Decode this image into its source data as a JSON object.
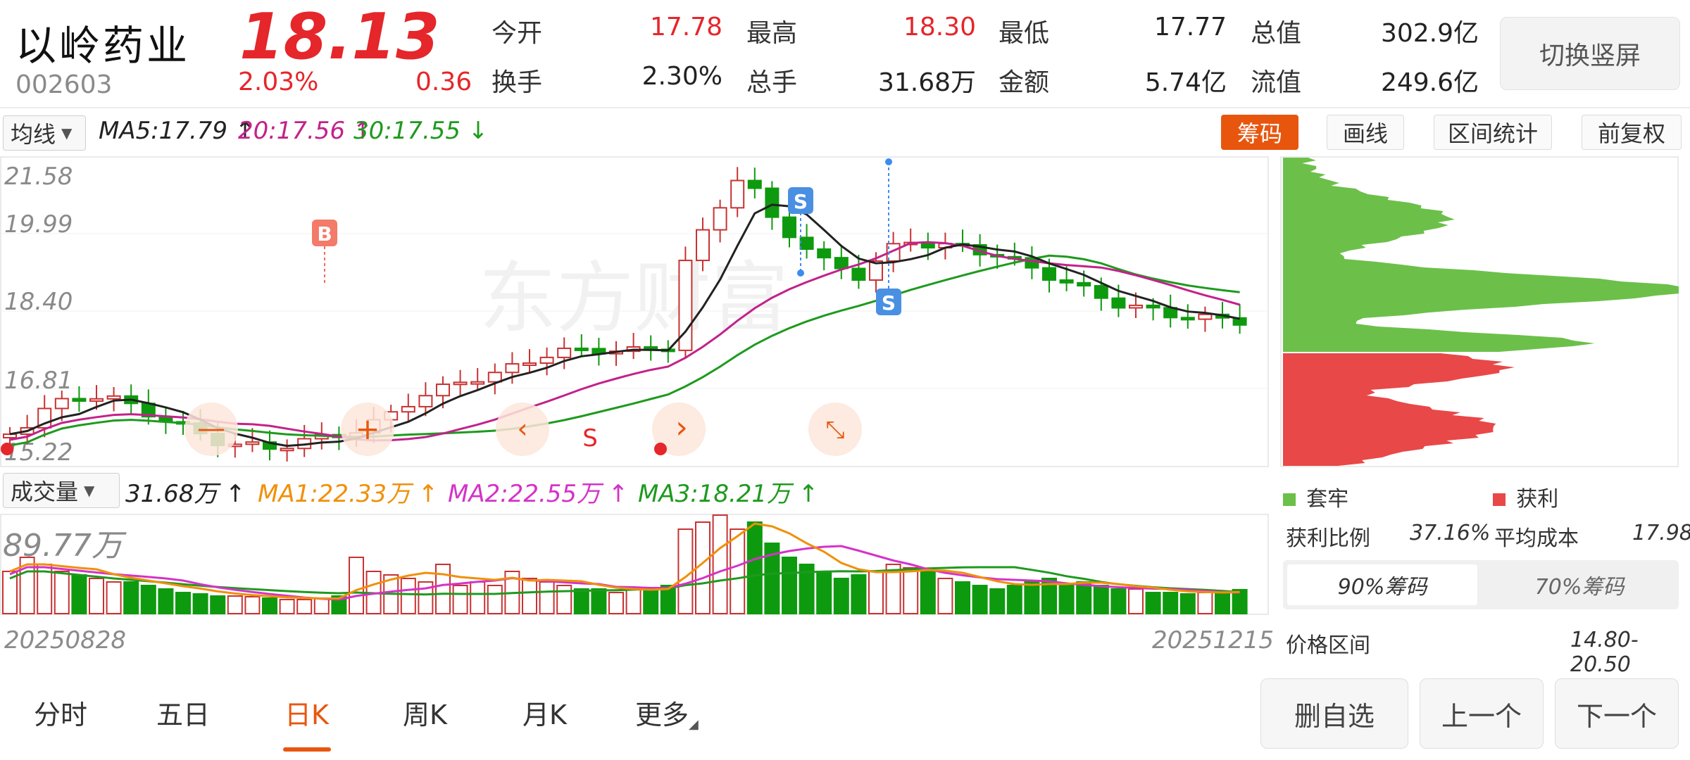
{
  "stock": {
    "name": "以岭药业",
    "code": "002603",
    "price": "18.13",
    "change_pct": "2.03%",
    "change": "0.36"
  },
  "stats": [
    {
      "label": "今开",
      "value": "17.78",
      "color": "#e5262a"
    },
    {
      "label": "最高",
      "value": "18.30",
      "color": "#e5262a"
    },
    {
      "label": "最低",
      "value": "17.77",
      "color": "#222222"
    },
    {
      "label": "总值",
      "value": "302.9亿",
      "color": "#222222"
    },
    {
      "label": "换手",
      "value": "2.30%",
      "color": "#222222"
    },
    {
      "label": "总手",
      "value": "31.68万",
      "color": "#222222"
    },
    {
      "label": "金额",
      "value": "5.74亿",
      "color": "#222222"
    },
    {
      "label": "流值",
      "value": "249.6亿",
      "color": "#222222"
    }
  ],
  "switch_label": "切换竖屏",
  "ma_row": {
    "selector": "均线",
    "ma5": "MA5:17.79",
    "ma20": "20:17.56",
    "ma30": "30:17.55",
    "buttons": [
      "筹码",
      "画线",
      "区间统计",
      "前复权"
    ]
  },
  "kline": {
    "y_ticks": [
      "21.58",
      "19.99",
      "18.40",
      "16.81",
      "15.22"
    ],
    "watermark": "东方财富",
    "markers": {
      "buy": "B",
      "sell": "S",
      "signal_s": "S"
    }
  },
  "volume": {
    "selector": "成交量",
    "value": "31.68万",
    "ma1": "MA1:22.33万",
    "ma2": "MA2:22.55万",
    "ma3": "MA3:18.21万",
    "max_label": "89.77万"
  },
  "dates": {
    "start": "20250828",
    "end": "20251215"
  },
  "chips": {
    "legend": [
      "套牢",
      "获利"
    ],
    "profit_ratio_label": "获利比例",
    "profit_ratio": "37.16%",
    "avg_cost_label": "平均成本",
    "avg_cost": "17.98",
    "tabs": [
      "90%筹码",
      "70%筹码"
    ],
    "range_label": "价格区间",
    "range": "14.80-20.50"
  },
  "bottom_tabs": [
    "分时",
    "五日",
    "日K",
    "周K",
    "月K",
    "更多"
  ],
  "bottom_buttons": [
    "删自选",
    "上一个",
    "下一个"
  ],
  "colors": {
    "up": "#e5262a",
    "down": "#1e9a1e",
    "ma5": "#222222",
    "ma20": "#c2228a",
    "ma30": "#1e9a1e",
    "accent": "#e8560e"
  }
}
